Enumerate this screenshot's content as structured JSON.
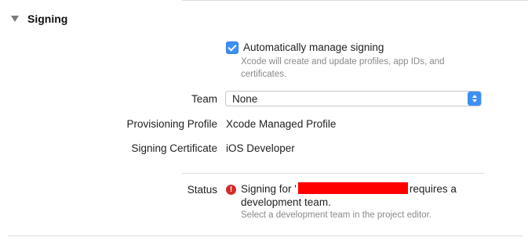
{
  "section": {
    "title": "Signing"
  },
  "auto_signing": {
    "label": "Automatically manage signing",
    "checked": true,
    "hint_line1": "Xcode will create and update profiles, app IDs, and",
    "hint_line2": "certificates."
  },
  "team": {
    "label": "Team",
    "value": "None"
  },
  "provisioning_profile": {
    "label": "Provisioning Profile",
    "value": "Xcode Managed Profile"
  },
  "signing_certificate": {
    "label": "Signing Certificate",
    "value": "iOS Developer"
  },
  "status": {
    "label": "Status",
    "message_prefix": "Signing for",
    "message_suffix": "requires a",
    "message_line2": "development team.",
    "hint": "Select a development team in the project editor.",
    "icon": "error-icon"
  },
  "colors": {
    "accent": "#3b8ff5",
    "error": "#d42a2a",
    "redaction": "#ff0000"
  }
}
